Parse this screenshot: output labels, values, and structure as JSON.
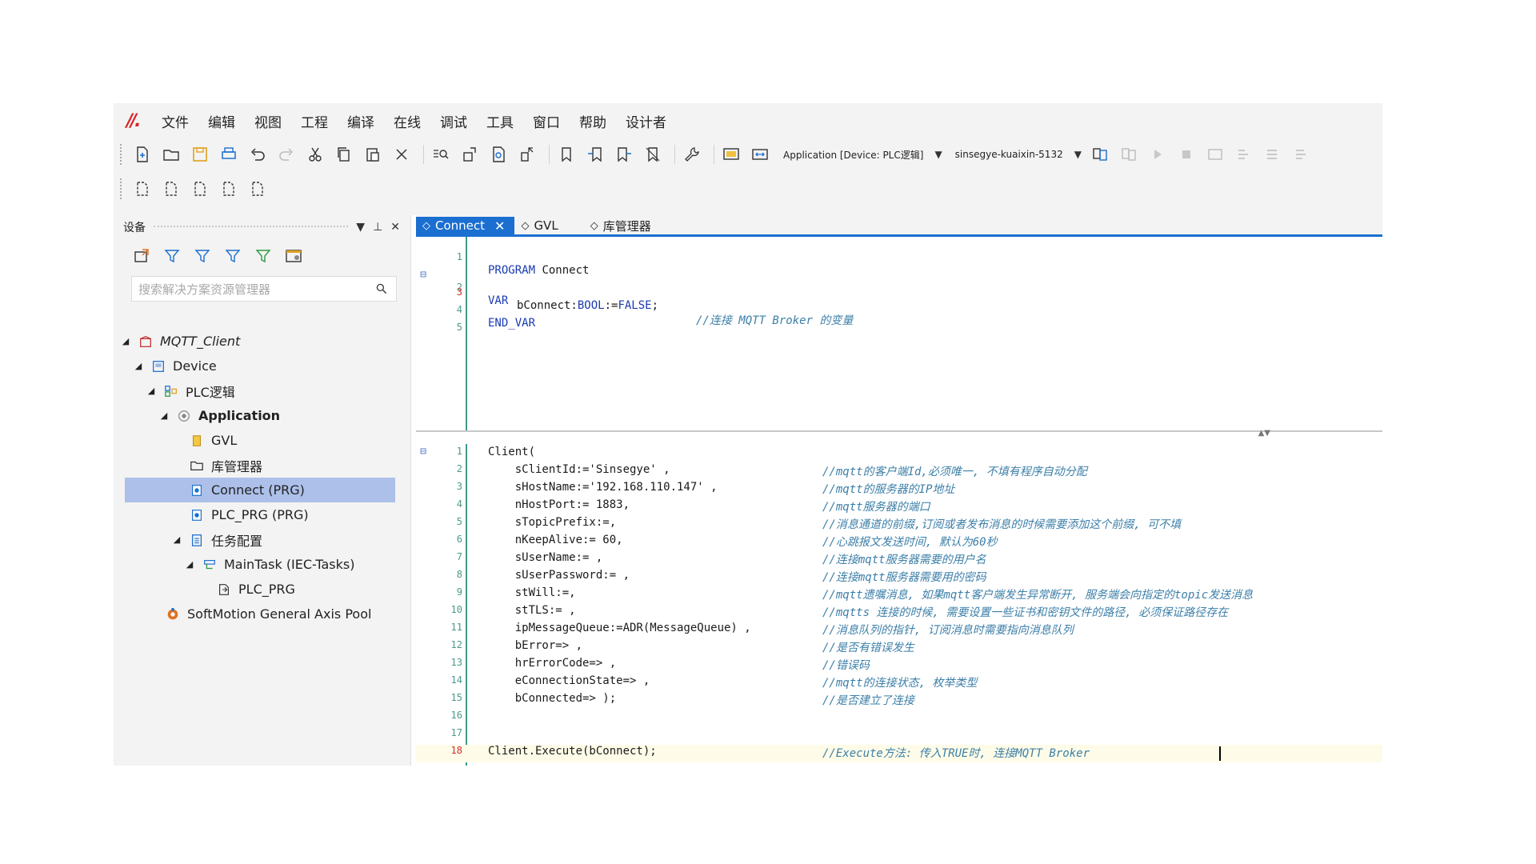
{
  "menu": {
    "logo_text": "//.",
    "items": [
      "文件",
      "编辑",
      "视图",
      "工程",
      "编译",
      "在线",
      "调试",
      "工具",
      "窗口",
      "帮助",
      "设计者"
    ]
  },
  "toolbar": {
    "application_combo": "Application [Device: PLC逻辑]",
    "device_combo": "sinsegye-kuaixin-5132"
  },
  "devices_panel": {
    "title": "设备",
    "search_placeholder": "搜索解决方案资源管理器",
    "tree": [
      {
        "label": "MQTT_Client",
        "icon": "project-icon"
      },
      {
        "label": "Device",
        "icon": "device-icon"
      },
      {
        "label": "PLC逻辑",
        "icon": "plc-logic-icon"
      },
      {
        "label": "Application",
        "icon": "application-icon"
      },
      {
        "label": "GVL",
        "icon": "gvl-icon"
      },
      {
        "label": "库管理器",
        "icon": "library-icon"
      },
      {
        "label": "Connect (PRG)",
        "icon": "program-icon"
      },
      {
        "label": "PLC_PRG (PRG)",
        "icon": "program-icon"
      },
      {
        "label": "任务配置",
        "icon": "task-config-icon"
      },
      {
        "label": "MainTask (IEC-Tasks)",
        "icon": "task-icon"
      },
      {
        "label": "PLC_PRG",
        "icon": "pou-call-icon"
      },
      {
        "label": "SoftMotion General Axis Pool",
        "icon": "axis-pool-icon"
      }
    ]
  },
  "editor": {
    "tabs": [
      {
        "label": "Connect",
        "active": true
      },
      {
        "label": "GVL",
        "active": false
      },
      {
        "label": "库管理器",
        "active": false
      }
    ],
    "declaration": {
      "line_numbers": [
        "1",
        "2",
        "3",
        "4",
        "5"
      ],
      "l1_kw": "PROGRAM",
      "l1_name": " Connect",
      "l2_kw": "VAR",
      "l3_name": "bConnect:",
      "l3_type": "BOOL",
      "l3_assign": ":=",
      "l3_val": "FALSE",
      "l3_end": ";",
      "l3_comment": "//连接 MQTT Broker 的变量",
      "l4_kw": "END_VAR"
    },
    "body": {
      "line_numbers": [
        "1",
        "2",
        "3",
        "4",
        "5",
        "6",
        "7",
        "8",
        "9",
        "10",
        "11",
        "12",
        "13",
        "14",
        "15",
        "16",
        "17",
        "18"
      ],
      "code": [
        "Client(",
        "    sClientId:='Sinsegye' ,",
        "    sHostName:='192.168.110.147' ,",
        "    nHostPort:= 1883,",
        "    sTopicPrefix:=,",
        "    nKeepAlive:= 60,",
        "    sUserName:= ,",
        "    sUserPassword:= ,",
        "    stWill:=,",
        "    stTLS:= ,",
        "    ipMessageQueue:=ADR(MessageQueue) ,",
        "    bError=> ,",
        "    hrErrorCode=> ,",
        "    eConnectionState=> ,",
        "    bConnected=> );",
        "",
        "",
        "Client.Execute(bConnect);"
      ],
      "comments": [
        "",
        "//mqtt的客户端Id,必须唯一, 不填有程序自动分配",
        "//mqtt的服务器的IP地址",
        "//mqtt服务器的端口",
        "//消息通道的前缀,订阅或者发布消息的时候需要添加这个前缀, 可不填",
        "//心跳报文发送时间, 默认为60秒",
        "//连接mqtt服务器需要的用户名",
        "//连接mqtt服务器需要用的密码",
        "//mqtt遗嘱消息, 如果mqtt客户端发生异常断开, 服务端会向指定的topic发送消息",
        "//mqtts 连接的时候, 需要设置一些证书和密钥文件的路径, 必须保证路径存在",
        "//消息队列的指针, 订阅消息时需要指向消息队列",
        "//是否有错误发生",
        "//错误码",
        "//mqtt的连接状态, 枚举类型",
        "//是否建立了连接",
        "",
        "",
        "//Execute方法: 传入TRUE时, 连接MQTT Broker"
      ]
    }
  }
}
